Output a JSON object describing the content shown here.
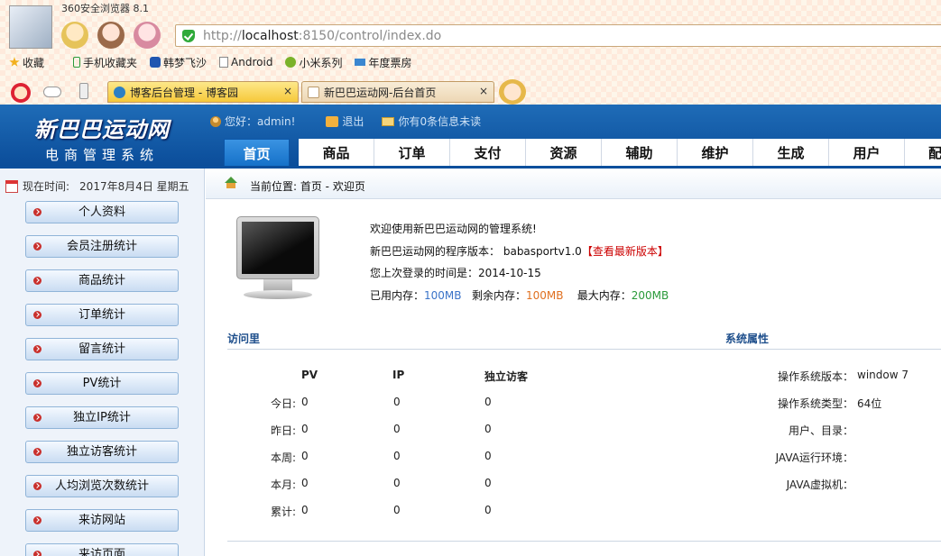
{
  "browser": {
    "title": "360安全浏览器 8.1",
    "url_scheme": "http://",
    "url_host": "localhost",
    "url_rest": ":8150/control/index.do",
    "bookmarks": [
      "收藏",
      "手机收藏夹",
      "韩梦飞沙",
      "Android",
      "小米系列",
      "年度票房"
    ],
    "tabs": [
      {
        "label": "博客后台管理 - 博客园",
        "close": "×"
      },
      {
        "label": "新巴巴运动网-后台首页",
        "close": "×"
      }
    ]
  },
  "header": {
    "logo": "新巴巴运动网",
    "subtitle": "电商管理系统",
    "greeting": "您好：admin!",
    "logout": "退出",
    "messages": "你有0条信息未读"
  },
  "nav": [
    "首页",
    "商品",
    "订单",
    "支付",
    "资源",
    "辅助",
    "维护",
    "生成",
    "用户",
    "配置"
  ],
  "sidebar": {
    "time_label": "现在时间:",
    "time_value": "2017年8月4日 星期五",
    "items": [
      "个人资料",
      "会员注册统计",
      "商品统计",
      "订单统计",
      "留言统计",
      "PV统计",
      "独立IP统计",
      "独立访客统计",
      "人均浏览次数统计",
      "来访网站",
      "来访页面"
    ]
  },
  "main": {
    "breadcrumb": "当前位置: 首页 - 欢迎页",
    "welcome": "欢迎使用新巴巴运动网的管理系统!",
    "version_label": "新巴巴运动网的程序版本：",
    "version_value": "babasportv1.0",
    "version_link": "【查看最新版本】",
    "last_login_label": "您上次登录的时间是：",
    "last_login_value": "2014-10-15",
    "mem_used_label": "已用内存：",
    "mem_used": "100MB",
    "mem_free_label": "剩余内存：",
    "mem_free": "100MB",
    "mem_max_label": "最大内存：",
    "mem_max": "200MB"
  },
  "visits": {
    "title": "访问里",
    "headers": [
      "PV",
      "IP",
      "独立访客"
    ],
    "rows": [
      {
        "label": "今日:",
        "pv": "0",
        "ip": "0",
        "uv": "0"
      },
      {
        "label": "昨日:",
        "pv": "0",
        "ip": "0",
        "uv": "0"
      },
      {
        "label": "本周:",
        "pv": "0",
        "ip": "0",
        "uv": "0"
      },
      {
        "label": "本月:",
        "pv": "0",
        "ip": "0",
        "uv": "0"
      },
      {
        "label": "累计:",
        "pv": "0",
        "ip": "0",
        "uv": "0"
      }
    ]
  },
  "system": {
    "title": "系统属性",
    "items": [
      {
        "label": "操作系统版本：",
        "value": "window 7"
      },
      {
        "label": "操作系统类型：",
        "value": "64位"
      },
      {
        "label": "用户、目录：",
        "value": ""
      },
      {
        "label": "JAVA运行环境：",
        "value": ""
      },
      {
        "label": "JAVA虚拟机：",
        "value": ""
      }
    ]
  }
}
